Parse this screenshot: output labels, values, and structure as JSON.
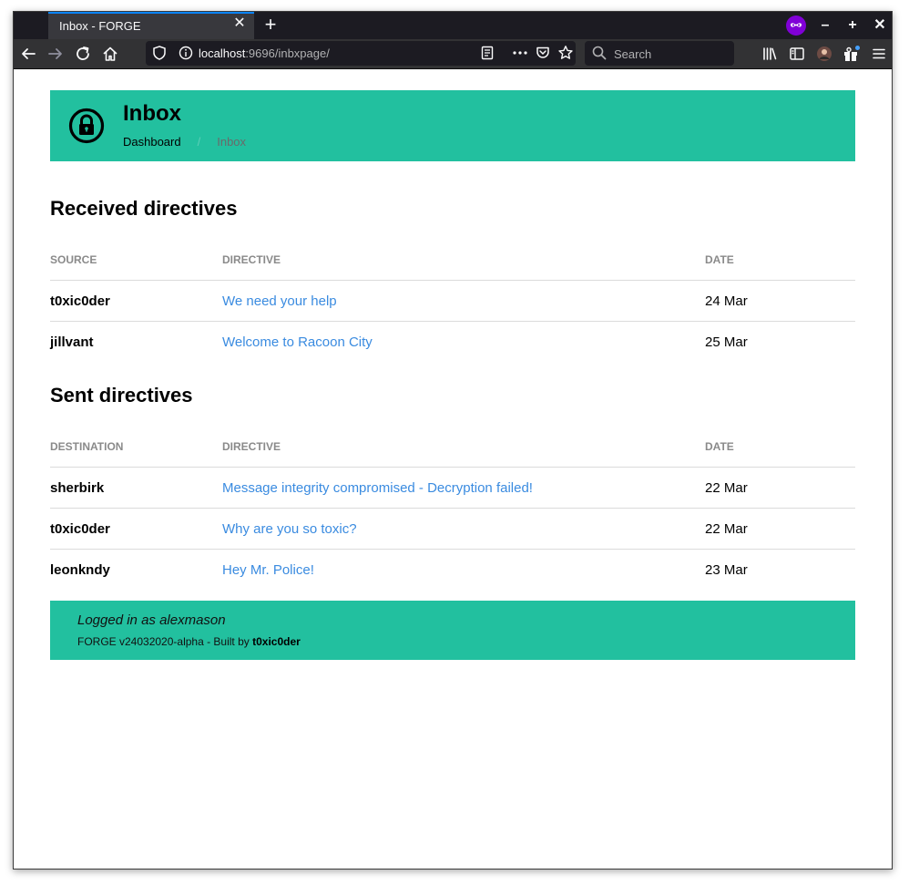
{
  "browser": {
    "tab_title": "Inbox - FORGE",
    "tab_close": "✕",
    "new_tab": "+",
    "url_host": "localhost",
    "url_rest": ":9696/inbxpage/",
    "search_placeholder": "Search",
    "window_controls": {
      "minimize": "–",
      "maximize": "+",
      "close": "✕"
    }
  },
  "header": {
    "title": "Inbox",
    "breadcrumb": {
      "home": "Dashboard",
      "separator": "/",
      "current": "Inbox"
    }
  },
  "received": {
    "title": "Received directives",
    "columns": [
      "SOURCE",
      "DIRECTIVE",
      "DATE"
    ],
    "rows": [
      {
        "user": "t0xic0der",
        "directive": "We need your help",
        "date": "24 Mar"
      },
      {
        "user": "jillvant",
        "directive": "Welcome to Racoon City",
        "date": "25 Mar"
      }
    ]
  },
  "sent": {
    "title": "Sent directives",
    "columns": [
      "DESTINATION",
      "DIRECTIVE",
      "DATE"
    ],
    "rows": [
      {
        "user": "sherbirk",
        "directive": "Message integrity compromised - Decryption failed!",
        "date": "22 Mar"
      },
      {
        "user": "t0xic0der",
        "directive": "Why are you so toxic?",
        "date": "22 Mar"
      },
      {
        "user": "leonkndy",
        "directive": "Hey Mr. Police!",
        "date": "23 Mar"
      }
    ]
  },
  "footer": {
    "logged_in": "Logged in as alexmason",
    "build_prefix": "FORGE v24032020-alpha - Built by",
    "build_author": "t0xic0der"
  },
  "colors": {
    "accent": "#22c09f",
    "link": "#3a8be0",
    "browser_chrome": "#323234",
    "tab_strip": "#1c1b22"
  }
}
